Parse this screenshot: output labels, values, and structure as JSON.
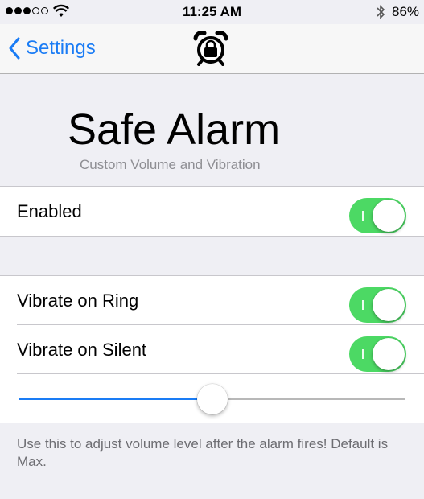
{
  "status_bar": {
    "signal_dots_filled": 3,
    "signal_dots_total": 5,
    "time": "11:25 AM",
    "battery_percent": "86%"
  },
  "nav": {
    "back_label": "Settings",
    "icon": "alarm-clock-lock-icon"
  },
  "header": {
    "title": "Safe Alarm",
    "subtitle": "Custom Volume and Vibration"
  },
  "groups": {
    "enabled": {
      "label": "Enabled",
      "on": true
    },
    "vibrate_ring": {
      "label": "Vibrate on Ring",
      "on": true
    },
    "vibrate_silent": {
      "label": "Vibrate on Silent",
      "on": true
    },
    "volume_slider": {
      "value": 0.5
    }
  },
  "footer_text": "Use this to adjust volume level after the alarm fires! Default is Max.",
  "colors": {
    "accent": "#1a7cf5",
    "switch_on": "#4cd964",
    "background": "#efeff4"
  }
}
